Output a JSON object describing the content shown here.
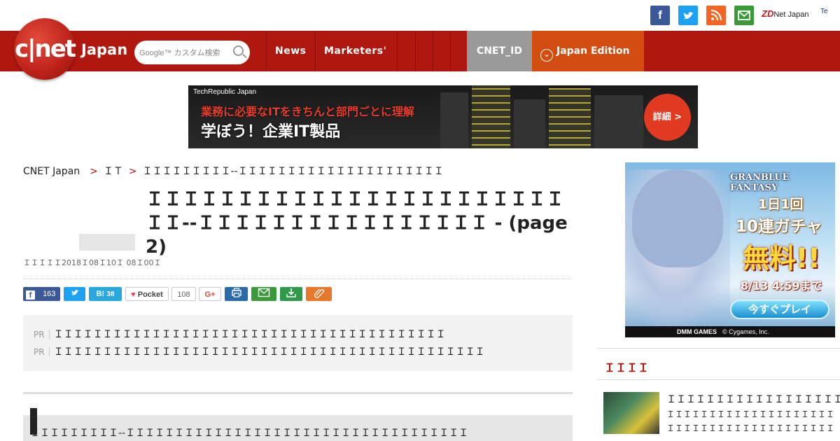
{
  "social": {
    "facebook": "f",
    "twitter": "t",
    "rss": "rss",
    "mail": "mail",
    "zdnet_mark": "ZD",
    "zdnet_label": "Net Japan",
    "techrepublic_label": "Te"
  },
  "site": {
    "logo_text": "c|net",
    "logo_suffix": "Japan"
  },
  "search": {
    "placeholder": "Google™ カスタム検索"
  },
  "nav": {
    "items": [
      "News",
      "Marketers'"
    ],
    "cnet_id": "CNET_ID",
    "edition": "Japan Edition"
  },
  "banner": {
    "brand": "TechRepublic Japan",
    "line1": "業務に必要なITをきちんと部門ごとに理解",
    "line2": "学ぼう！企業IT製品",
    "cta": "詳細 >"
  },
  "breadcrumb": {
    "home": "CNET Japan",
    "section": "ＩＴ",
    "current": "ＩＩＩＩＩＩＩＩＩ--ＩＩＩＩＩＩＩＩＩＩＩＩＩＩＩＩＩＩＩＩＩ"
  },
  "article": {
    "title": "ＩＩＩＩＩＩＩＩＩＩＩＩＩＩＩＩＩＩＩＩＩＩＩＩＩ--ＩＩＩＩＩＩＩＩＩＩＩＩＩＩＩＩ - (page 2)",
    "date": "ＩＩＩＩＩ2018Ｉ08Ｉ10Ｉ 08Ｉ00Ｉ"
  },
  "share": {
    "facebook_count": "163",
    "hatena_label": "B!",
    "hatena_count": "38",
    "pocket_label": "Pocket",
    "pocket_count": "108",
    "gplus_label": "G+"
  },
  "pr": {
    "tag": "PR",
    "items": [
      "ＩＩＩＩＩＩＩＩＩＩＩＩＩＩＩＩＩＩＩＩＩＩＩＩＩＩＩＩＩＩＩＩＩＩＩＩＩＩＩＩ",
      "ＩＩＩＩＩＩＩＩＩＩＩＩＩＩＩＩＩＩＩＩＩＩＩＩＩＩＩＩＩＩＩＩＩＩＩＩＩＩＩＩＩＩＩＩ"
    ]
  },
  "subhead": "ＩＩＩＩＩＩＩＩＩ--ＩＩＩＩＩＩＩＩＩＩＩＩＩＩＩＩＩＩＩＩＩＩＩＩＩＩＩＩＩＩＩＩＩＩＩ",
  "ad": {
    "game_title": "GRANBLUE FANTASY",
    "line1": "1日1回",
    "line2": "10連ガチャ",
    "line3": "無料!!",
    "line4": "8/13 4:59まで",
    "button": "今すぐプレイ",
    "publisher": "DMM GAMES",
    "copyright": "© Cygames, Inc."
  },
  "sidebar": {
    "heading": "ＩＩＩＩ",
    "item_title": "ＩＩＩＩＩＩＩＩＩＩＩＩＩＩＩＩＩＩ",
    "item_desc": [
      "ＩＩＩＩＩＩＩＩＩＩＩＩＩＩＩＩＩＩＩＩＩＩＩＩＩＩＩ",
      "ＩＩＩＩＩＩＩＩＩＩＩＩＩＩＩＩＩＩＩＩＩＩＩＩＩ"
    ]
  },
  "colors": {
    "nav_red": "#b0170f",
    "cnet_id_gray": "#9a9a9a",
    "edition_orange": "#d34d10",
    "facebook": "#3b5998",
    "twitter": "#1da1f2",
    "rss": "#f26522",
    "mail": "#3a9a3a"
  }
}
